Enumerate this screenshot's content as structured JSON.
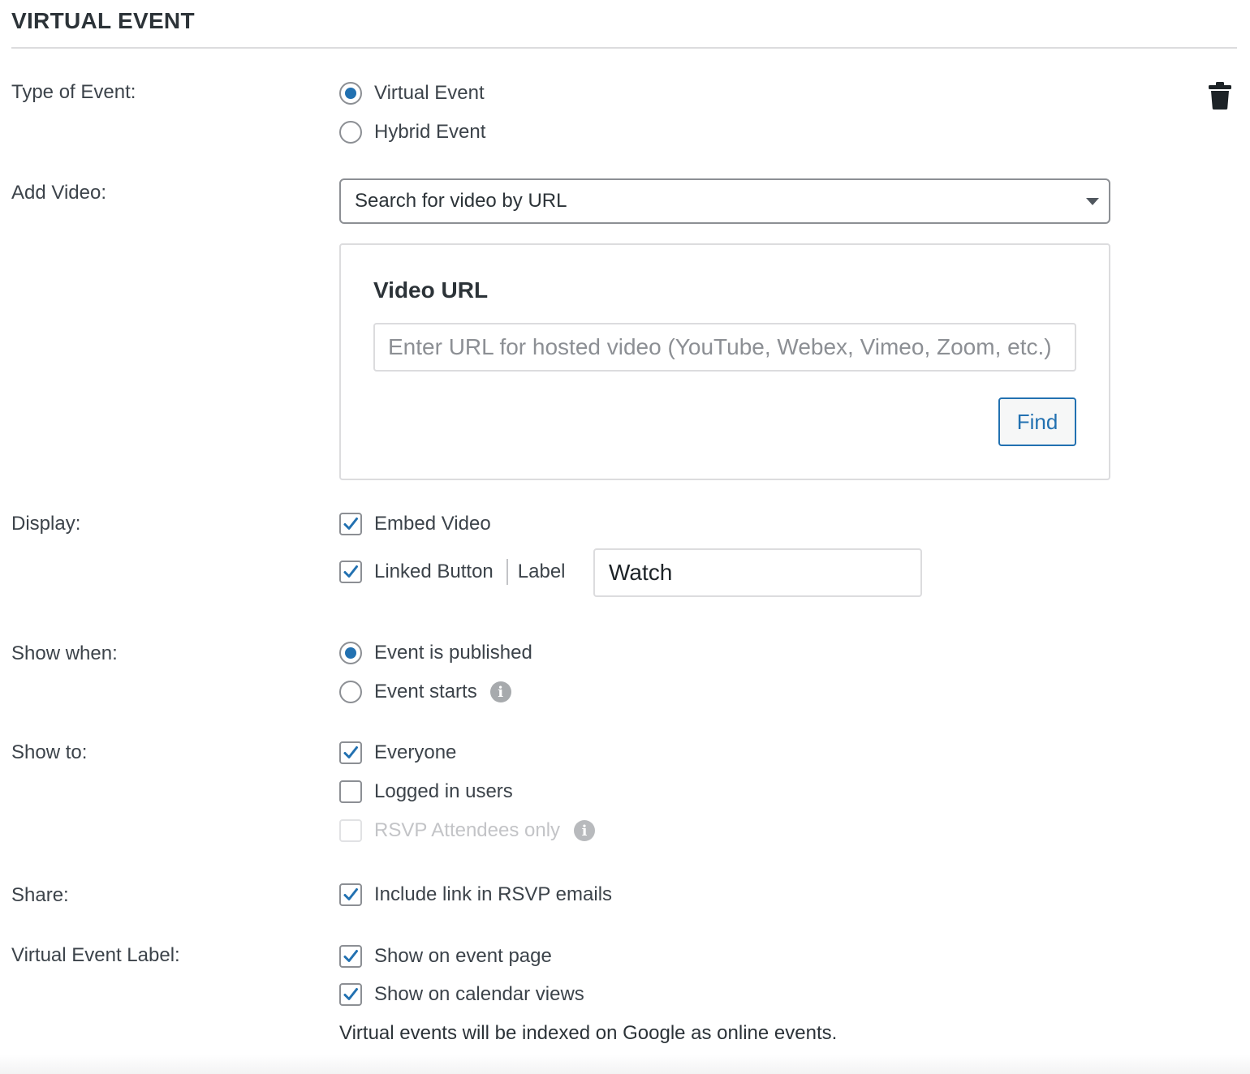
{
  "section": {
    "title": "VIRTUAL EVENT"
  },
  "type_of_event": {
    "label": "Type of Event:",
    "options": [
      {
        "label": "Virtual Event",
        "selected": true
      },
      {
        "label": "Hybrid Event",
        "selected": false
      }
    ]
  },
  "add_video": {
    "label": "Add Video:",
    "select_value": "Search for video by URL",
    "panel": {
      "heading": "Video URL",
      "input_value": "",
      "input_placeholder": "Enter URL for hosted video (YouTube, Webex, Vimeo, Zoom, etc.)",
      "find_label": "Find"
    }
  },
  "display": {
    "label": "Display:",
    "embed_video": {
      "label": "Embed Video",
      "checked": true
    },
    "linked_button": {
      "label": "Linked Button",
      "checked": true,
      "field_label": "Label",
      "field_value": "Watch"
    }
  },
  "show_when": {
    "label": "Show when:",
    "options": [
      {
        "label": "Event is published",
        "selected": true
      },
      {
        "label": "Event starts",
        "selected": false
      }
    ]
  },
  "show_to": {
    "label": "Show to:",
    "options": [
      {
        "label": "Everyone",
        "checked": true,
        "disabled": false
      },
      {
        "label": "Logged in users",
        "checked": false,
        "disabled": false
      },
      {
        "label": "RSVP Attendees only",
        "checked": false,
        "disabled": true
      }
    ]
  },
  "share": {
    "label": "Share:",
    "options": [
      {
        "label": "Include link in RSVP emails",
        "checked": true
      }
    ]
  },
  "virtual_event_label": {
    "label": "Virtual Event Label:",
    "options": [
      {
        "label": "Show on event page",
        "checked": true
      },
      {
        "label": "Show on calendar views",
        "checked": true
      }
    ],
    "note": "Virtual events will be indexed on Google as online events."
  },
  "icons": {
    "delete": "trash-icon",
    "info": "info-icon",
    "check": "checkmark-icon",
    "dropdown": "chevron-down-icon"
  },
  "colors": {
    "accent": "#2271b1",
    "text": "#2c3338",
    "border": "#8c8f94",
    "disabled": "#c3c4c7"
  }
}
